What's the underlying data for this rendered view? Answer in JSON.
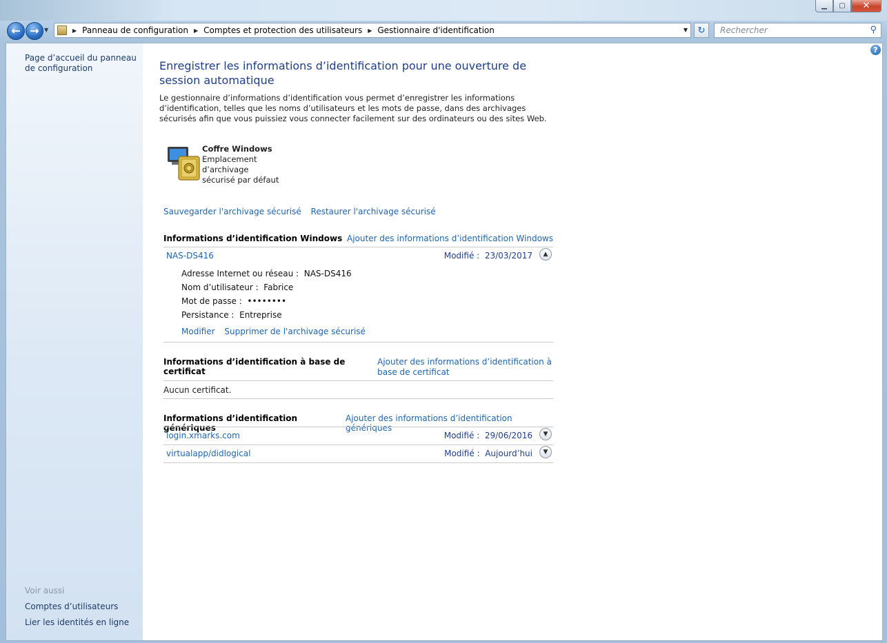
{
  "window": {
    "minimize": "▁",
    "maximize": "▢",
    "close": "✕"
  },
  "nav": {
    "back": "←",
    "forward": "→",
    "breadcrumb": [
      "Panneau de configuration",
      "Comptes et protection des utilisateurs",
      "Gestionnaire d'identification"
    ],
    "search_placeholder": "Rechercher"
  },
  "sidebar": {
    "home": "Page d’accueil du panneau de configuration",
    "see_also": "Voir aussi",
    "links": [
      "Comptes d’utilisateurs",
      "Lier les identités en ligne"
    ]
  },
  "main": {
    "title": "Enregistrer les informations d’identification pour une ouverture de session automatique",
    "description": "Le gestionnaire d’informations d’identification vous permet d’enregistrer les informations d’identification, telles que les noms d’utilisateurs et les mots de passe, dans des archivages sécurisés afin que vous puissiez vous connecter facilement sur des ordinateurs ou des sites Web.",
    "vault": {
      "name": "Coffre Windows",
      "desc": "Emplacement d’archivage sécurisé par défaut"
    },
    "backup_link": "Sauvegarder l'archivage sécurisé",
    "restore_link": "Restaurer l'archivage sécurisé",
    "windows_section": {
      "heading": "Informations d’identification Windows",
      "add_link": "Ajouter des informations d’identification Windows",
      "entry": {
        "name": "NAS-DS416",
        "modified_label": "Modifié :",
        "modified_value": "23/03/2017",
        "address_label": "Adresse Internet ou réseau :",
        "address_value": "NAS-DS416",
        "user_label": "Nom d’utilisateur :",
        "user_value": "Fabrice",
        "password_label": "Mot de passe :",
        "password_value": "••••••••",
        "persistence_label": "Persistance :",
        "persistence_value": "Entreprise",
        "edit_link": "Modifier",
        "remove_link": "Supprimer de l'archivage sécurisé"
      }
    },
    "cert_section": {
      "heading": "Informations d’identification à base de certificat",
      "add_link": "Ajouter des informations d’identification à base de certificat",
      "empty": "Aucun certificat."
    },
    "generic_section": {
      "heading": "Informations d’identification génériques",
      "add_link": "Ajouter des informations d’identification génériques",
      "entries": [
        {
          "name": "login.xmarks.com",
          "modified_label": "Modifié :",
          "modified_value": "29/06/2016"
        },
        {
          "name": "virtualapp/didlogical",
          "modified_label": "Modifié :",
          "modified_value": "Aujourd’hui"
        }
      ]
    }
  }
}
